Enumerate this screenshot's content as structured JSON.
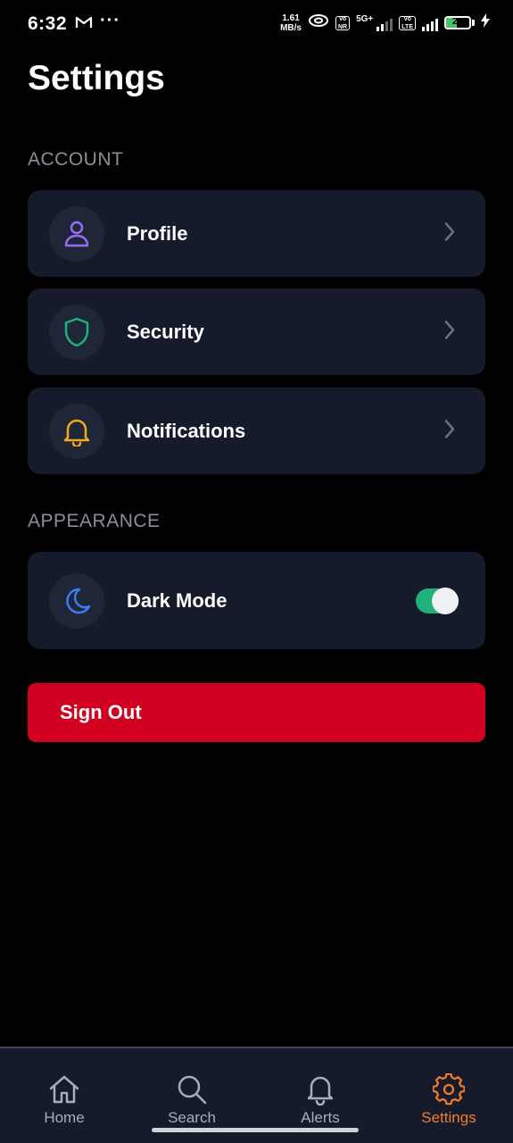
{
  "status_bar": {
    "time": "6:32",
    "net_speed_value": "1.61",
    "net_speed_unit": "MB/s",
    "volte1_top": "Vo",
    "volte1_bottom": "NR",
    "network_5g": "5G+",
    "volte2_top": "Vo",
    "volte2_bottom": "LTE",
    "battery_level": "24"
  },
  "header": {
    "title": "Settings"
  },
  "sections": {
    "account": {
      "label": "ACCOUNT",
      "items": [
        {
          "label": "Profile",
          "icon": "person-icon",
          "icon_color": "#9b6cf3"
        },
        {
          "label": "Security",
          "icon": "shield-icon",
          "icon_color": "#1fb17a"
        },
        {
          "label": "Notifications",
          "icon": "bell-icon",
          "icon_color": "#f4a81d"
        }
      ]
    },
    "appearance": {
      "label": "APPEARANCE",
      "items": [
        {
          "label": "Dark Mode",
          "icon": "moon-icon",
          "icon_color": "#3f7cf0",
          "toggle_on": true
        }
      ]
    }
  },
  "sign_out": {
    "label": "Sign Out",
    "color": "#d10021"
  },
  "bottom_nav": {
    "active": "Settings",
    "active_color": "#f07c2a",
    "items": [
      {
        "label": "Home",
        "icon": "home-icon"
      },
      {
        "label": "Search",
        "icon": "search-icon"
      },
      {
        "label": "Alerts",
        "icon": "bell-icon"
      },
      {
        "label": "Settings",
        "icon": "gear-icon"
      }
    ]
  }
}
